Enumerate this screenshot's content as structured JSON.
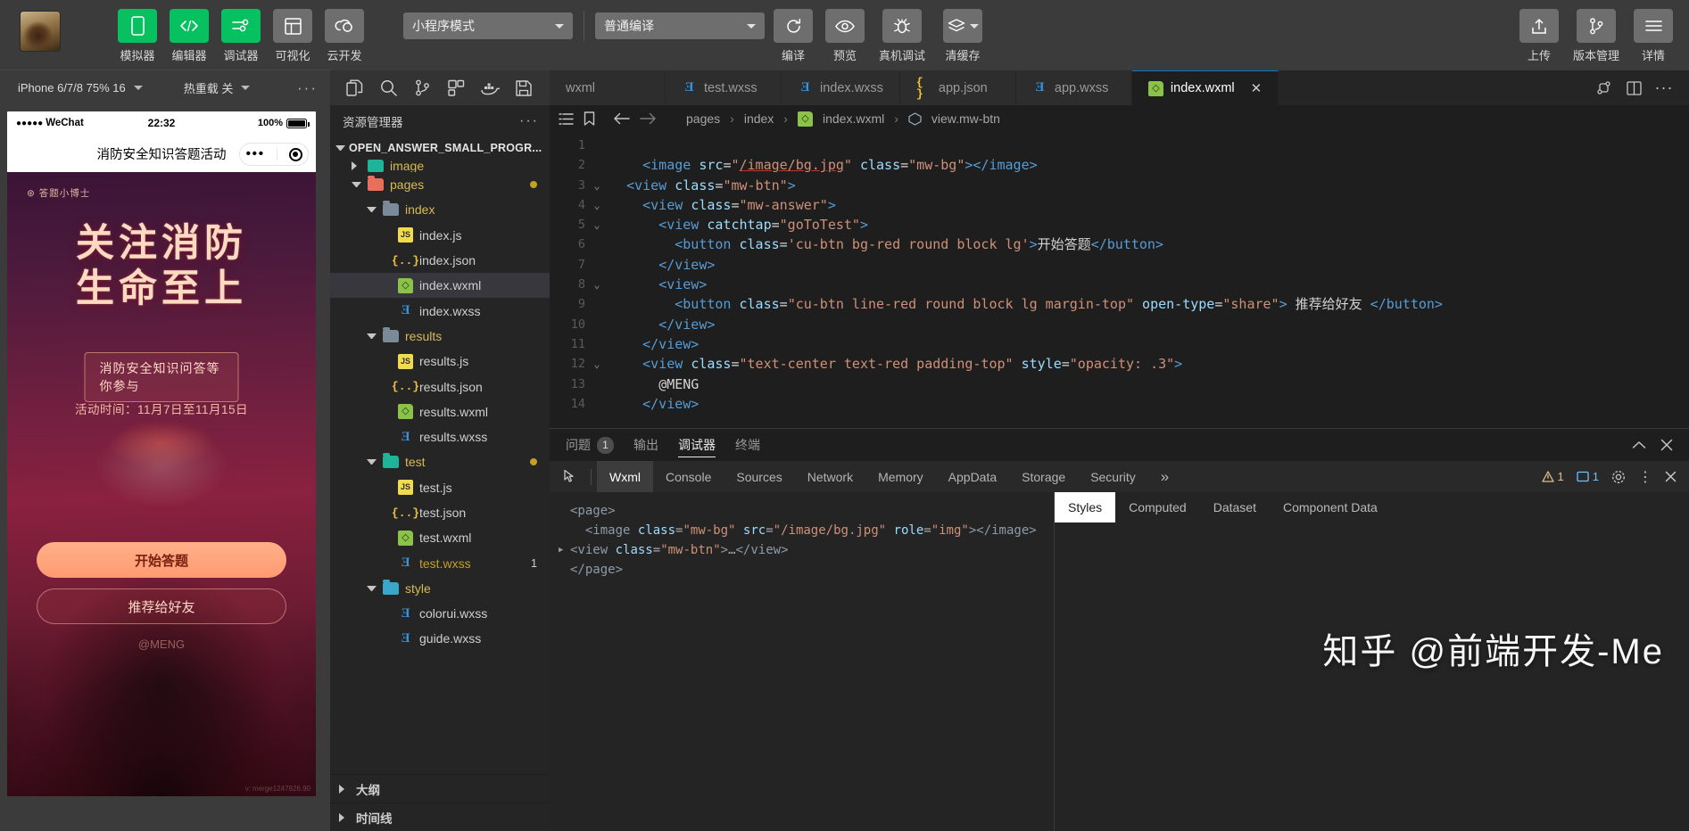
{
  "toolbar": {
    "items": [
      {
        "label": "模拟器",
        "icon": "phone-icon",
        "style": "green"
      },
      {
        "label": "编辑器",
        "icon": "code-icon",
        "style": "green"
      },
      {
        "label": "调试器",
        "icon": "sliders-icon",
        "style": "green"
      },
      {
        "label": "可视化",
        "icon": "layout-icon",
        "style": "grey"
      },
      {
        "label": "云开发",
        "icon": "cloud-icon",
        "style": "grey"
      }
    ],
    "mode_select": "小程序模式",
    "compile_select": "普通编译",
    "actions": [
      {
        "label": "编译",
        "icon": "refresh-icon"
      },
      {
        "label": "预览",
        "icon": "eye-icon"
      },
      {
        "label": "真机调试",
        "icon": "bug-icon"
      },
      {
        "label": "清缓存",
        "icon": "layers-icon"
      }
    ],
    "right_actions": [
      {
        "label": "上传",
        "icon": "upload-icon"
      },
      {
        "label": "版本管理",
        "icon": "branch-icon"
      },
      {
        "label": "详情",
        "icon": "menu-icon"
      }
    ]
  },
  "secondbar": {
    "device": "iPhone 6/7/8 75% 16",
    "hotreload": "热重载 关",
    "more": "···",
    "icons": [
      "split-file-icon",
      "search-icon",
      "source-control-icon",
      "debug-icon",
      "docker-icon",
      "save-icon"
    ]
  },
  "tabs": [
    {
      "label": "wxml",
      "type": "plain",
      "active": false
    },
    {
      "label": "test.wxss",
      "type": "wxss",
      "active": false
    },
    {
      "label": "index.wxss",
      "type": "wxss",
      "active": false
    },
    {
      "label": "app.json",
      "type": "json",
      "active": false
    },
    {
      "label": "app.wxss",
      "type": "wxss",
      "active": false
    },
    {
      "label": "index.wxml",
      "type": "wxml",
      "active": true,
      "close": "✕"
    }
  ],
  "simulator": {
    "status": {
      "signal": "●●●●●",
      "carrier": "WeChat",
      "time": "22:32",
      "battery_pct": "100%"
    },
    "nav_title": "消防安全知识答题活动",
    "poster": {
      "badge": "⊛ 答题小博士",
      "title_line1": "关注消防",
      "title_line2": "生命至上",
      "subtitle": "消防安全知识问答等你参与",
      "date": "活动时间：11月7日至11月15日",
      "primary_button": "开始答题",
      "ghost_button": "推荐给好友",
      "signature": "@MENG",
      "watermark": "v: merge1247826.90"
    }
  },
  "explorer": {
    "title": "资源管理器",
    "more": "···",
    "root": "OPEN_ANSWER_SMALL_PROGR...",
    "tree": [
      {
        "label": "image",
        "kind": "folder",
        "color": "teal",
        "indent": 1,
        "clipped": true
      },
      {
        "label": "pages",
        "kind": "folder",
        "color": "red",
        "indent": 1,
        "open": true,
        "modified": true
      },
      {
        "label": "index",
        "kind": "folder",
        "color": "grey",
        "indent": 2,
        "open": true
      },
      {
        "label": "index.js",
        "kind": "js",
        "indent": 3
      },
      {
        "label": "index.json",
        "kind": "json",
        "indent": 3
      },
      {
        "label": "index.wxml",
        "kind": "wxml",
        "indent": 3,
        "selected": true
      },
      {
        "label": "index.wxss",
        "kind": "wxss",
        "indent": 3
      },
      {
        "label": "results",
        "kind": "folder",
        "color": "grey",
        "indent": 2,
        "open": true
      },
      {
        "label": "results.js",
        "kind": "js",
        "indent": 3
      },
      {
        "label": "results.json",
        "kind": "json",
        "indent": 3
      },
      {
        "label": "results.wxml",
        "kind": "wxml",
        "indent": 3
      },
      {
        "label": "results.wxss",
        "kind": "wxss",
        "indent": 3
      },
      {
        "label": "test",
        "kind": "folder",
        "color": "teal",
        "indent": 2,
        "open": true,
        "modified": true
      },
      {
        "label": "test.js",
        "kind": "js",
        "indent": 3
      },
      {
        "label": "test.json",
        "kind": "json",
        "indent": 3
      },
      {
        "label": "test.wxml",
        "kind": "wxml",
        "indent": 3
      },
      {
        "label": "test.wxss",
        "kind": "wxss",
        "indent": 3,
        "dirty": true,
        "badge": "1"
      },
      {
        "label": "style",
        "kind": "folder",
        "color": "cyan",
        "indent": 2,
        "open": true
      },
      {
        "label": "colorui.wxss",
        "kind": "wxss",
        "indent": 3
      },
      {
        "label": "guide.wxss",
        "kind": "wxss",
        "indent": 3
      }
    ],
    "sections": [
      {
        "label": "大纲"
      },
      {
        "label": "时间线"
      }
    ]
  },
  "breadcrumb": {
    "icons": [
      "outline-icon",
      "bookmark-icon",
      "back-arrow-icon",
      "forward-arrow-icon"
    ],
    "parts": [
      "pages",
      "index",
      "index.wxml",
      "view.mw-btn"
    ]
  },
  "code": {
    "lines": [
      {
        "n": "1",
        "fold": "",
        "segments": []
      },
      {
        "n": "2",
        "fold": "",
        "segments": [
          {
            "t": "punct",
            "v": "    "
          },
          {
            "t": "tag",
            "v": "<image"
          },
          {
            "t": "txt",
            "v": " "
          },
          {
            "t": "attr",
            "v": "src"
          },
          {
            "t": "punct",
            "v": "="
          },
          {
            "t": "str",
            "v": "\""
          },
          {
            "t": "link",
            "v": "/image/bg.jpg"
          },
          {
            "t": "str",
            "v": "\""
          },
          {
            "t": "txt",
            "v": " "
          },
          {
            "t": "attr",
            "v": "class"
          },
          {
            "t": "punct",
            "v": "="
          },
          {
            "t": "str",
            "v": "\"mw-bg\""
          },
          {
            "t": "tag",
            "v": ">"
          },
          {
            "t": "tag",
            "v": "</image>"
          }
        ]
      },
      {
        "n": "3",
        "fold": "⌄",
        "segments": [
          {
            "t": "punct",
            "v": "  "
          },
          {
            "t": "tag",
            "v": "<view"
          },
          {
            "t": "txt",
            "v": " "
          },
          {
            "t": "attr",
            "v": "class"
          },
          {
            "t": "punct",
            "v": "="
          },
          {
            "t": "str",
            "v": "\"mw-btn\""
          },
          {
            "t": "tag",
            "v": ">"
          }
        ]
      },
      {
        "n": "4",
        "fold": "⌄",
        "segments": [
          {
            "t": "punct",
            "v": "    "
          },
          {
            "t": "tag",
            "v": "<view"
          },
          {
            "t": "txt",
            "v": " "
          },
          {
            "t": "attr",
            "v": "class"
          },
          {
            "t": "punct",
            "v": "="
          },
          {
            "t": "str",
            "v": "\"mw-answer\""
          },
          {
            "t": "tag",
            "v": ">"
          }
        ]
      },
      {
        "n": "5",
        "fold": "⌄",
        "segments": [
          {
            "t": "punct",
            "v": "      "
          },
          {
            "t": "tag",
            "v": "<view"
          },
          {
            "t": "txt",
            "v": " "
          },
          {
            "t": "attr",
            "v": "catchtap"
          },
          {
            "t": "punct",
            "v": "="
          },
          {
            "t": "str",
            "v": "\"goToTest\""
          },
          {
            "t": "tag",
            "v": ">"
          }
        ]
      },
      {
        "n": "6",
        "fold": "",
        "segments": [
          {
            "t": "punct",
            "v": "        "
          },
          {
            "t": "tag",
            "v": "<button"
          },
          {
            "t": "txt",
            "v": " "
          },
          {
            "t": "attr",
            "v": "class"
          },
          {
            "t": "punct",
            "v": "="
          },
          {
            "t": "str",
            "v": "'cu-btn bg-red round block lg'"
          },
          {
            "t": "tag",
            "v": ">"
          },
          {
            "t": "txt",
            "v": "开始答题"
          },
          {
            "t": "tag",
            "v": "</button>"
          }
        ]
      },
      {
        "n": "7",
        "fold": "",
        "segments": [
          {
            "t": "punct",
            "v": "      "
          },
          {
            "t": "tag",
            "v": "</view>"
          }
        ]
      },
      {
        "n": "8",
        "fold": "⌄",
        "segments": [
          {
            "t": "punct",
            "v": "      "
          },
          {
            "t": "tag",
            "v": "<view>"
          }
        ]
      },
      {
        "n": "9",
        "fold": "",
        "segments": [
          {
            "t": "punct",
            "v": "        "
          },
          {
            "t": "tag",
            "v": "<button"
          },
          {
            "t": "txt",
            "v": " "
          },
          {
            "t": "attr",
            "v": "class"
          },
          {
            "t": "punct",
            "v": "="
          },
          {
            "t": "str",
            "v": "\"cu-btn line-red round block lg margin-top\""
          },
          {
            "t": "txt",
            "v": " "
          },
          {
            "t": "attr",
            "v": "open-type"
          },
          {
            "t": "punct",
            "v": "="
          },
          {
            "t": "str",
            "v": "\"share\""
          },
          {
            "t": "tag",
            "v": ">"
          },
          {
            "t": "txt",
            "v": " 推荐给好友 "
          },
          {
            "t": "tag",
            "v": "</button>"
          }
        ]
      },
      {
        "n": "10",
        "fold": "",
        "segments": [
          {
            "t": "punct",
            "v": "      "
          },
          {
            "t": "tag",
            "v": "</view>"
          }
        ]
      },
      {
        "n": "11",
        "fold": "",
        "segments": [
          {
            "t": "punct",
            "v": "    "
          },
          {
            "t": "tag",
            "v": "</view>"
          }
        ]
      },
      {
        "n": "12",
        "fold": "⌄",
        "segments": [
          {
            "t": "punct",
            "v": "    "
          },
          {
            "t": "tag",
            "v": "<view"
          },
          {
            "t": "txt",
            "v": " "
          },
          {
            "t": "attr",
            "v": "class"
          },
          {
            "t": "punct",
            "v": "="
          },
          {
            "t": "str",
            "v": "\"text-center text-red padding-top\""
          },
          {
            "t": "txt",
            "v": " "
          },
          {
            "t": "attr",
            "v": "style"
          },
          {
            "t": "punct",
            "v": "="
          },
          {
            "t": "str",
            "v": "\"opacity: .3\""
          },
          {
            "t": "tag",
            "v": ">"
          }
        ]
      },
      {
        "n": "13",
        "fold": "",
        "segments": [
          {
            "t": "punct",
            "v": "      "
          },
          {
            "t": "txt",
            "v": "@MENG"
          }
        ]
      },
      {
        "n": "14",
        "fold": "",
        "segments": [
          {
            "t": "punct",
            "v": "    "
          },
          {
            "t": "tag",
            "v": "</view>"
          }
        ]
      }
    ]
  },
  "panel": {
    "tabs": [
      {
        "label": "问题",
        "count": "1",
        "active": false
      },
      {
        "label": "输出",
        "count": "",
        "active": false
      },
      {
        "label": "调试器",
        "count": "",
        "active": true
      },
      {
        "label": "终端",
        "count": "",
        "active": false
      }
    ],
    "collapse_icon": "chevron-up-icon",
    "close_icon": "close-icon"
  },
  "devtools": {
    "tabs": [
      {
        "label": "Wxml",
        "active": true
      },
      {
        "label": "Console",
        "active": false
      },
      {
        "label": "Sources",
        "active": false
      },
      {
        "label": "Network",
        "active": false
      },
      {
        "label": "Memory",
        "active": false
      },
      {
        "label": "AppData",
        "active": false
      },
      {
        "label": "Storage",
        "active": false
      },
      {
        "label": "Security",
        "active": false
      }
    ],
    "overflow": "»",
    "warn_count": "1",
    "info_count": "1",
    "settings_icon": "gear-icon",
    "kebab_icon": "kebab-icon",
    "close_icon": "close-icon",
    "dom": [
      {
        "indent": 0,
        "arrow": "",
        "segments": [
          {
            "t": "tag",
            "v": "<page>"
          }
        ]
      },
      {
        "indent": 1,
        "arrow": "",
        "segments": [
          {
            "t": "tag",
            "v": "<image"
          },
          {
            "t": "plain",
            "v": " "
          },
          {
            "t": "attr",
            "v": "class"
          },
          {
            "t": "plain",
            "v": "="
          },
          {
            "t": "val",
            "v": "\"mw-bg\""
          },
          {
            "t": "plain",
            "v": " "
          },
          {
            "t": "attr",
            "v": "src"
          },
          {
            "t": "plain",
            "v": "="
          },
          {
            "t": "val",
            "v": "\"/image/bg.jpg\""
          },
          {
            "t": "plain",
            "v": " "
          },
          {
            "t": "attr",
            "v": "role"
          },
          {
            "t": "plain",
            "v": "="
          },
          {
            "t": "val",
            "v": "\"img\""
          },
          {
            "t": "tag",
            "v": "></image>"
          }
        ]
      },
      {
        "indent": 0,
        "arrow": "▶",
        "segments": [
          {
            "t": "tag",
            "v": "<view"
          },
          {
            "t": "plain",
            "v": " "
          },
          {
            "t": "attr",
            "v": "class"
          },
          {
            "t": "plain",
            "v": "="
          },
          {
            "t": "val",
            "v": "\"mw-btn\""
          },
          {
            "t": "tag",
            "v": ">"
          },
          {
            "t": "plain",
            "v": "…"
          },
          {
            "t": "tag",
            "v": "</view>"
          }
        ]
      },
      {
        "indent": 0,
        "arrow": "",
        "segments": [
          {
            "t": "tag",
            "v": "</page>"
          }
        ]
      }
    ],
    "style_tabs": [
      {
        "label": "Styles",
        "active": true
      },
      {
        "label": "Computed",
        "active": false
      },
      {
        "label": "Dataset",
        "active": false
      },
      {
        "label": "Component Data",
        "active": false
      }
    ]
  },
  "watermark": "知乎 @前端开发-Me"
}
